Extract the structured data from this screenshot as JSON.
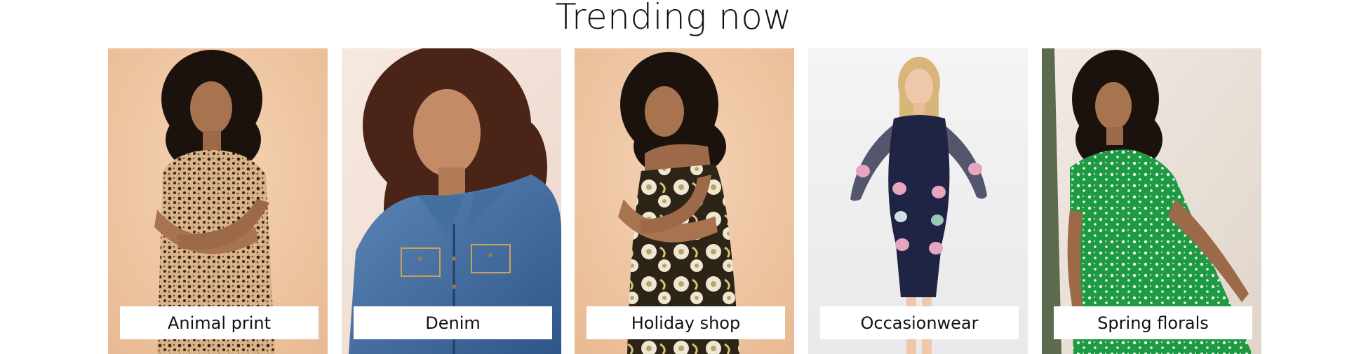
{
  "section": {
    "title": "Trending now"
  },
  "tiles": [
    {
      "label": "Animal print",
      "image": "model-leopard-print-dress",
      "background": "#efc7a4"
    },
    {
      "label": "Denim",
      "image": "model-denim-jacket",
      "background": "#f3e3da"
    },
    {
      "label": "Holiday shop",
      "image": "model-floral-sleeveless-dress",
      "background": "#efc7a4"
    },
    {
      "label": "Occasionwear",
      "image": "model-navy-floral-occasion-dress",
      "background": "#f2f2f3"
    },
    {
      "label": "Spring florals",
      "image": "model-green-floral-dress",
      "background": "#ece4dd"
    }
  ]
}
